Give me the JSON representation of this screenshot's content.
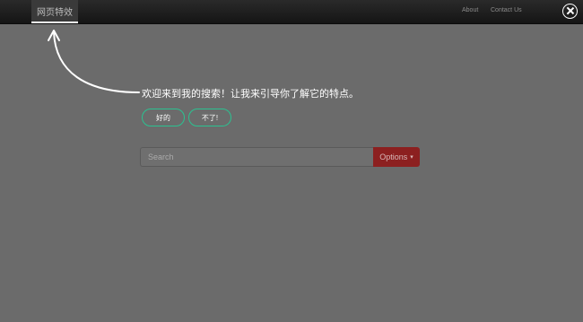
{
  "navbar": {
    "brand": "网页特效",
    "links": [
      "About",
      "Contact Us"
    ]
  },
  "tour": {
    "message": "欢迎来到我的搜索！让我来引导你了解它的特点。",
    "buttons": [
      "好的",
      "不了!"
    ]
  },
  "search": {
    "placeholder": "Search",
    "options_label": "Options",
    "caret": "▾"
  },
  "icons": {
    "close": "close-icon",
    "arrow": "curved-arrow-icon"
  },
  "colors": {
    "overlay": "#6b6b6b",
    "accent": "#2bc291",
    "options_button": "#8c2020"
  }
}
